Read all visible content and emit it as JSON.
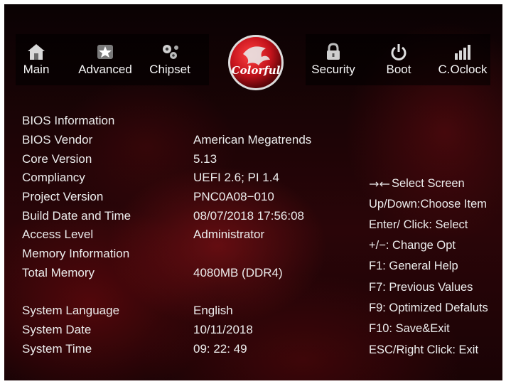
{
  "nav": {
    "tabs": [
      {
        "label": "Main",
        "icon": "home-icon"
      },
      {
        "label": "Advanced",
        "icon": "advanced-star-icon"
      },
      {
        "label": "Chipset",
        "icon": "gears-icon"
      },
      {
        "label": "Security",
        "icon": "lock-icon"
      },
      {
        "label": "Boot",
        "icon": "power-icon"
      },
      {
        "label": "C.Oclock",
        "icon": "bars-icon"
      }
    ],
    "logo_text": "Colorful"
  },
  "main": {
    "rows": [
      {
        "label": "BIOS Information",
        "value": ""
      },
      {
        "label": "BIOS Vendor",
        "value": "American Megatrends"
      },
      {
        "label": "Core Version",
        "value": "5.13"
      },
      {
        "label": "Compliancy",
        "value": "UEFI 2.6; PI 1.4"
      },
      {
        "label": "Project Version",
        "value": "PNC0A08−010"
      },
      {
        "label": "Build Date and Time",
        "value": "08/07/2018 17:56:08"
      },
      {
        "label": "Access Level",
        "value": "Administrator"
      },
      {
        "label": "Memory Information",
        "value": ""
      },
      {
        "label": "Total  Memory",
        "value": "4080MB (DDR4)"
      },
      {
        "label": "System Language",
        "value": "English"
      },
      {
        "label": "System Date",
        "value": "10/11/2018"
      },
      {
        "label": "System Time",
        "value": "09: 22: 49"
      }
    ]
  },
  "help": {
    "lines": [
      "Select Screen",
      "Up/Down:Choose Item",
      "Enter/ Click: Select",
      "+/−: Change Opt",
      "F1: General Help",
      "F7: Previous Values",
      "F9: Optimized Defaluts",
      "F10: Save&Exit",
      "ESC/Right Click: Exit"
    ]
  },
  "colors": {
    "background": "#1d0406",
    "accent": "#c4131c",
    "text": "#ececec"
  }
}
